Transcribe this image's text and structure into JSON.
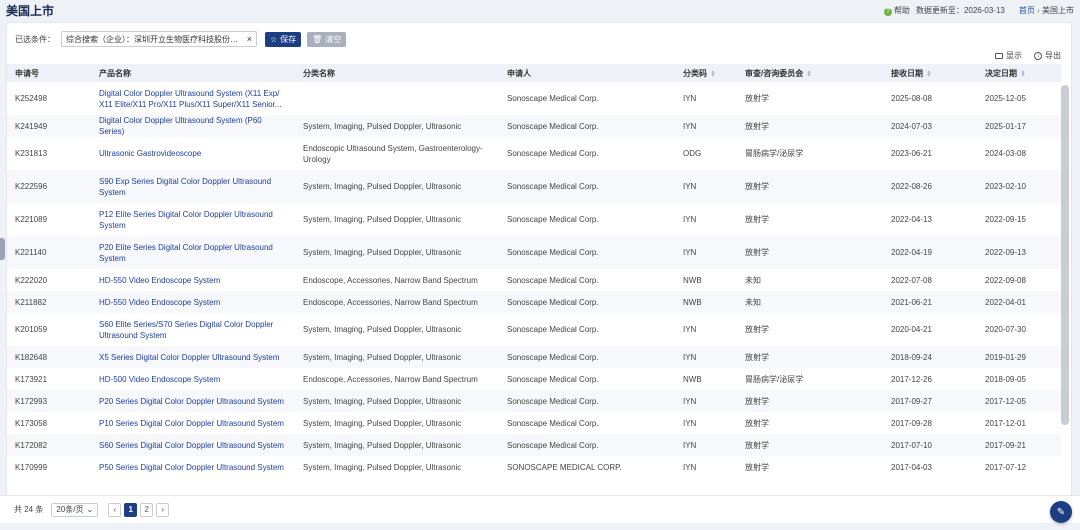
{
  "header": {
    "title": "美国上市",
    "help": "帮助",
    "update_label": "数据更新至：",
    "update_date": "2026-03-13",
    "crumb_home": "首页",
    "crumb_sep": "›",
    "crumb_current": "美国上市"
  },
  "filter": {
    "label": "已选条件：",
    "tag": "综合搜索（企业）：深圳开立生物医疗科技股份有...",
    "close": "×",
    "save": "保存",
    "clear": "清空"
  },
  "tools": {
    "display": "显示",
    "export": "导出"
  },
  "table": {
    "headers": [
      "申请号",
      "产品名称",
      "分类名称",
      "申请人",
      "分类码",
      "审查/咨询委员会",
      "接收日期",
      "决定日期"
    ],
    "sort_glyph": "⇕",
    "rows": [
      [
        "K252498",
        "Digital Color Doppler Ultrasound System (X11 Exp/ X11 Elite/X11 Pro/X11 Plus/X11 Super/X11 Senior...",
        "",
        "Sonoscape Medical Corp.",
        "IYN",
        "放射学",
        "2025-08-08",
        "2025-12-05"
      ],
      [
        "K241949",
        "Digital Color Doppler Ultrasound System (P60 Series)",
        "System, Imaging, Pulsed Doppler, Ultrasonic",
        "Sonoscape Medical Corp.",
        "IYN",
        "放射学",
        "2024-07-03",
        "2025-01-17"
      ],
      [
        "K231813",
        "Ultrasonic Gastrovideoscope",
        "Endoscopic Ultrasound System, Gastroenterology-Urology",
        "Sonoscape Medical Corp.",
        "ODG",
        "胃肠病学/泌尿学",
        "2023-06-21",
        "2024-03-08"
      ],
      [
        "K222596",
        "S90 Exp Series Digital Color Doppler Ultrasound System",
        "System, Imaging, Pulsed Doppler, Ultrasonic",
        "Sonoscape Medical Corp.",
        "IYN",
        "放射学",
        "2022-08-26",
        "2023-02-10"
      ],
      [
        "K221089",
        "P12 Elite Series Digital Color Doppler Ultrasound System",
        "System, Imaging, Pulsed Doppler, Ultrasonic",
        "Sonoscape Medical Corp.",
        "IYN",
        "放射学",
        "2022-04-13",
        "2022-09-15"
      ],
      [
        "K221140",
        "P20 Elite Series Digital Color Doppler Ultrasound System",
        "System, Imaging, Pulsed Doppler, Ultrasonic",
        "Sonoscape Medical Corp.",
        "IYN",
        "放射学",
        "2022-04-19",
        "2022-09-13"
      ],
      [
        "K222020",
        "HD-550 Video Endoscope System",
        "Endoscope, Accessories, Narrow Band Spectrum",
        "Sonoscape Medical Corp.",
        "NWB",
        "未知",
        "2022-07-08",
        "2022-09-08"
      ],
      [
        "K211882",
        "HD-550 Video Endoscope System",
        "Endoscope, Accessories, Narrow Band Spectrum",
        "Sonoscape Medical Corp.",
        "NWB",
        "未知",
        "2021-06-21",
        "2022-04-01"
      ],
      [
        "K201059",
        "S60 Elite Series/S70 Series Digital Color Doppler Ultrasound System",
        "System, Imaging, Pulsed Doppler, Ultrasonic",
        "Sonoscape Medical Corp.",
        "IYN",
        "放射学",
        "2020-04-21",
        "2020-07-30"
      ],
      [
        "K182648",
        "X5 Series Digital Color Doppler Ultrasound System",
        "System, Imaging, Pulsed Doppler, Ultrasonic",
        "Sonoscape Medical Corp.",
        "IYN",
        "放射学",
        "2018-09-24",
        "2019-01-29"
      ],
      [
        "K173921",
        "HD-500 Video Endoscope System",
        "Endoscope, Accessories, Narrow Band Spectrum",
        "Sonoscape Medical Corp.",
        "NWB",
        "胃肠病学/泌尿学",
        "2017-12-26",
        "2018-09-05"
      ],
      [
        "K172993",
        "P20 Series Digital Color Doppler Ultrasound System",
        "System, Imaging, Pulsed Doppler, Ultrasonic",
        "Sonoscape Medical Corp.",
        "IYN",
        "放射学",
        "2017-09-27",
        "2017-12-05"
      ],
      [
        "K173058",
        "P10 Series Digital Color Doppler Ultrasound System",
        "System, Imaging, Pulsed Doppler, Ultrasonic",
        "Sonoscape Medical Corp.",
        "IYN",
        "放射学",
        "2017-09-28",
        "2017-12-01"
      ],
      [
        "K172082",
        "S60 Series Digital Color Doppler Ultrasound System",
        "System, Imaging, Pulsed Doppler, Ultrasonic",
        "Sonoscape Medical Corp.",
        "IYN",
        "放射学",
        "2017-07-10",
        "2017-09-21"
      ],
      [
        "K170999",
        "P50 Series Digital Color Doppler Ultrasound System",
        "System, Imaging, Pulsed Doppler, Ultrasonic",
        "SONOSCAPE MEDICAL CORP.",
        "IYN",
        "放射学",
        "2017-04-03",
        "2017-07-12"
      ]
    ]
  },
  "footer": {
    "total": "共 24 条",
    "page_size": "20条/页",
    "prev": "‹",
    "pages": [
      "1",
      "2"
    ],
    "next": "›"
  }
}
